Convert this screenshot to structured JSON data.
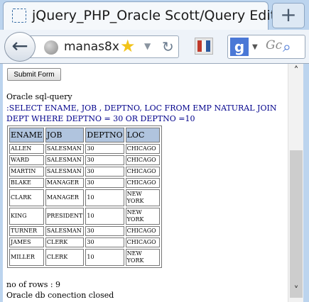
{
  "browser": {
    "tab_title": "jQuery_PHP_Oracle Scott/Query Editor",
    "new_tab_label": "+",
    "url": "manas8x",
    "search_engine": "Gc",
    "accent": "#4a78d6"
  },
  "page": {
    "submit_label": "Submit Form",
    "sql_label": "Oracle sql-query",
    "query": ":SELECT ENAME, JOB , DEPTNO, LOC FROM EMP NATURAL JOIN DEPT WHERE DEPTNO = 30 OR DEPTNO =10",
    "table": {
      "headers": [
        "ENAME",
        "JOB",
        "DEPTNO",
        "LOC"
      ],
      "rows": [
        [
          "ALLEN",
          "SALESMAN",
          "30",
          "CHICAGO"
        ],
        [
          "WARD",
          "SALESMAN",
          "30",
          "CHICAGO"
        ],
        [
          "MARTIN",
          "SALESMAN",
          "30",
          "CHICAGO"
        ],
        [
          "BLAKE",
          "MANAGER",
          "30",
          "CHICAGO"
        ],
        [
          "CLARK",
          "MANAGER",
          "10",
          "NEW YORK"
        ],
        [
          "KING",
          "PRESIDENT",
          "10",
          "NEW YORK"
        ],
        [
          "TURNER",
          "SALESMAN",
          "30",
          "CHICAGO"
        ],
        [
          "JAMES",
          "CLERK",
          "30",
          "CHICAGO"
        ],
        [
          "MILLER",
          "CLERK",
          "10",
          "NEW YORK"
        ]
      ],
      "header_color": "#b0c4de"
    },
    "row_count": "no of rows : 9",
    "closed_msg": "Oracle db conection closed"
  }
}
